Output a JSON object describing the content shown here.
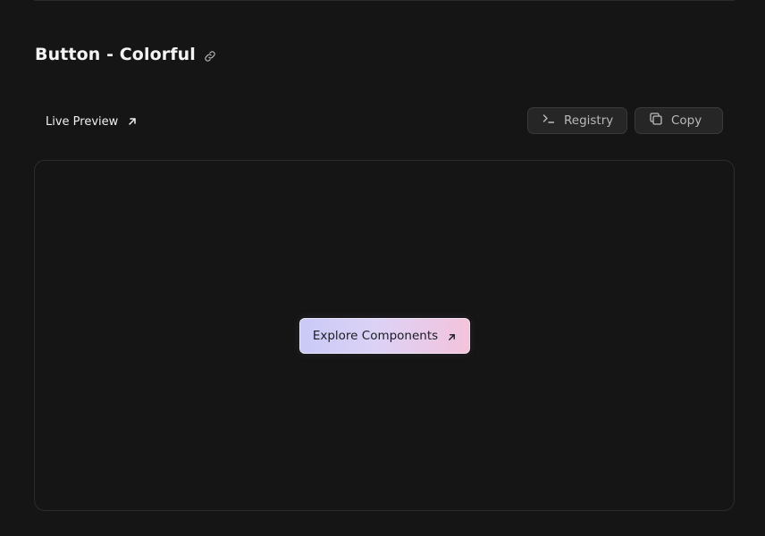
{
  "section": {
    "title": "Button - Colorful",
    "anchor_icon": "link-icon"
  },
  "preview_bar": {
    "live_preview_label": "Live Preview",
    "live_preview_icon": "arrow-up-right-icon",
    "registry_label": "Registry",
    "registry_icon": "terminal-icon",
    "copy_label": "Copy",
    "copy_icon": "copy-icon"
  },
  "preview": {
    "button_label": "Explore Components",
    "button_icon": "arrow-up-right-icon",
    "button_gradient": [
      "#c9c9f7",
      "#dcd2f6",
      "#f3c3dc"
    ]
  },
  "colors": {
    "background": "#151515",
    "panel_border": "#2c2c2c",
    "toolbar_button_bg": "#262626"
  }
}
